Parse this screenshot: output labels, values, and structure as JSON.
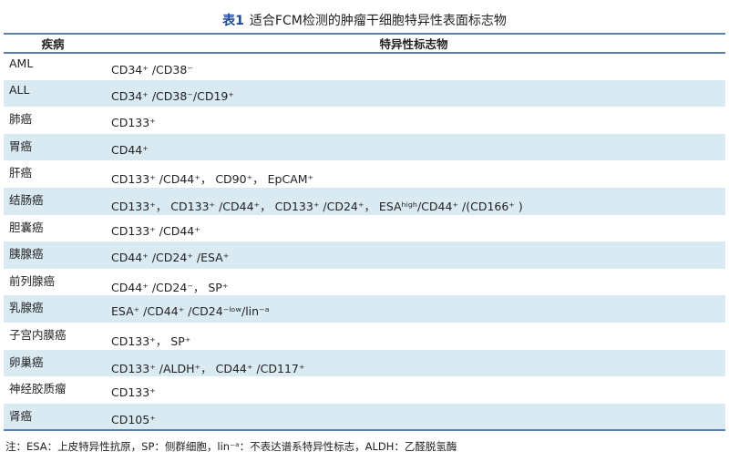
{
  "caption": {
    "number": "表1",
    "text": "适合FCM检测的肿瘤干细胞特异性表面标志物"
  },
  "table": {
    "headers": [
      "疾病",
      "特异性标志物"
    ],
    "rows": [
      {
        "disease": "AML",
        "markers": "CD34⁺ /CD38⁻"
      },
      {
        "disease": "ALL",
        "markers": "CD34⁺ /CD38⁻/CD19⁺"
      },
      {
        "disease": "肺癌",
        "markers": "CD133⁺"
      },
      {
        "disease": "胃癌",
        "markers": "CD44⁺"
      },
      {
        "disease": "肝癌",
        "markers": "CD133⁺ /CD44⁺， CD90⁺， EpCAM⁺"
      },
      {
        "disease": "结肠癌",
        "markers": "CD133⁺， CD133⁺ /CD44⁺， CD133⁺ /CD24⁺， ESAʰⁱᵍʰ/CD44⁺ /(CD166⁺ )"
      },
      {
        "disease": "胆囊癌",
        "markers": "CD133⁺ /CD44⁺"
      },
      {
        "disease": "胰腺癌",
        "markers": "CD44⁺ /CD24⁺ /ESA⁺"
      },
      {
        "disease": "前列腺癌",
        "markers": "CD44⁺ /CD24⁻， SP⁺"
      },
      {
        "disease": "乳腺癌",
        "markers": "ESA⁺ /CD44⁺ /CD24⁻ˡᵒʷ/lin⁻ᵃ"
      },
      {
        "disease": "子宫内膜癌",
        "markers": "CD133⁺， SP⁺"
      },
      {
        "disease": "卵巢癌",
        "markers": "CD133⁺ /ALDH⁺， CD44⁺ /CD117⁺"
      },
      {
        "disease": "神经胶质瘤",
        "markers": "CD133⁺"
      },
      {
        "disease": "肾癌",
        "markers": "CD105⁺"
      }
    ]
  },
  "note": "注：ESA：上皮特异性抗原，SP：侧群细胞，lin⁻ᵃ：不表达谱系特异性标志，ALDH：乙醛脱氢酶"
}
